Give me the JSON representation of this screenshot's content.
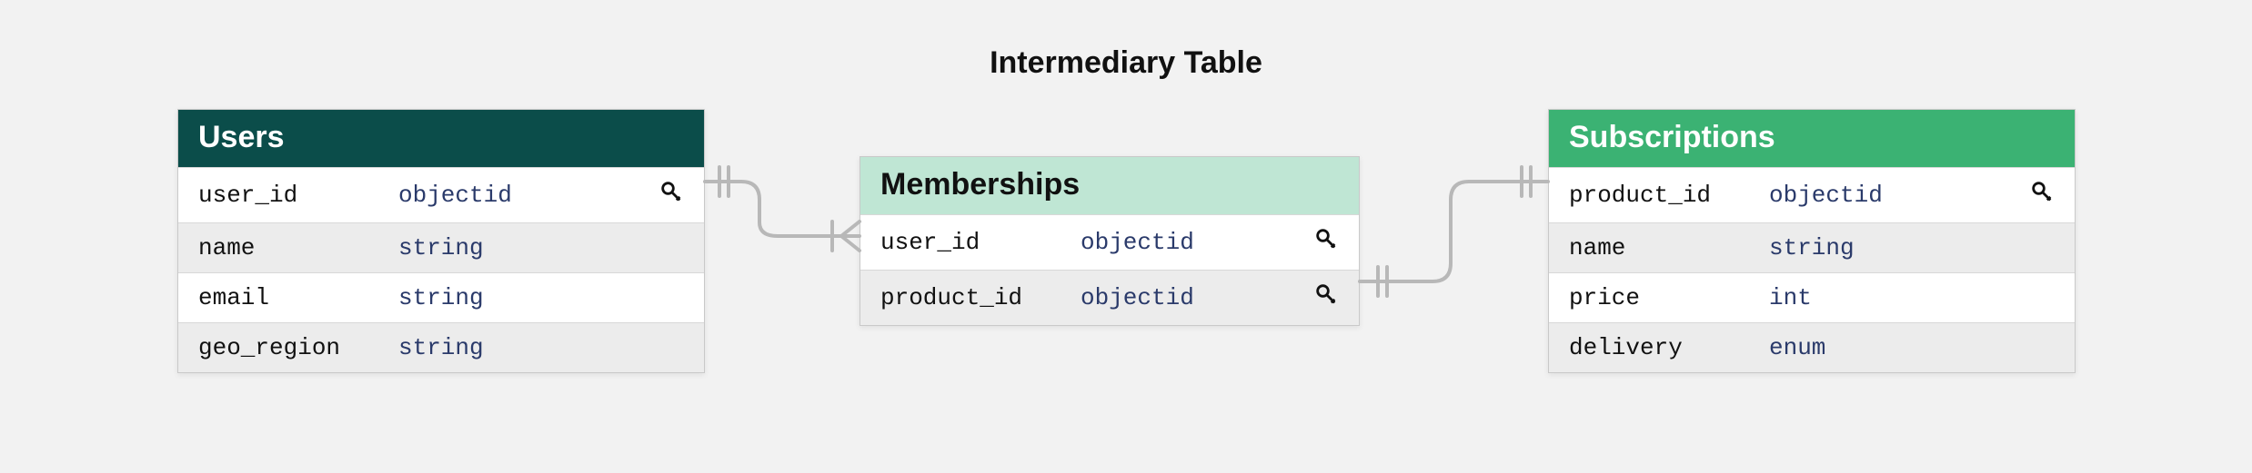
{
  "title": "Intermediary Table",
  "tables": {
    "users": {
      "name": "Users",
      "columns": [
        {
          "name": "user_id",
          "type": "objectid",
          "key": true
        },
        {
          "name": "name",
          "type": "string",
          "key": false
        },
        {
          "name": "email",
          "type": "string",
          "key": false
        },
        {
          "name": "geo_region",
          "type": "string",
          "key": false
        }
      ]
    },
    "memberships": {
      "name": "Memberships",
      "columns": [
        {
          "name": "user_id",
          "type": "objectid",
          "key": true
        },
        {
          "name": "product_id",
          "type": "objectid",
          "key": true
        }
      ]
    },
    "subscriptions": {
      "name": "Subscriptions",
      "columns": [
        {
          "name": "product_id",
          "type": "objectid",
          "key": true
        },
        {
          "name": "name",
          "type": "string",
          "key": false
        },
        {
          "name": "price",
          "type": "int",
          "key": false
        },
        {
          "name": "delivery",
          "type": "enum",
          "key": false
        }
      ]
    }
  },
  "relationships": [
    {
      "from": "users.user_id",
      "to": "memberships.user_id",
      "from_card": "one",
      "to_card": "many"
    },
    {
      "from": "subscriptions.product_id",
      "to": "memberships.product_id",
      "from_card": "one",
      "to_card": "many"
    }
  ]
}
